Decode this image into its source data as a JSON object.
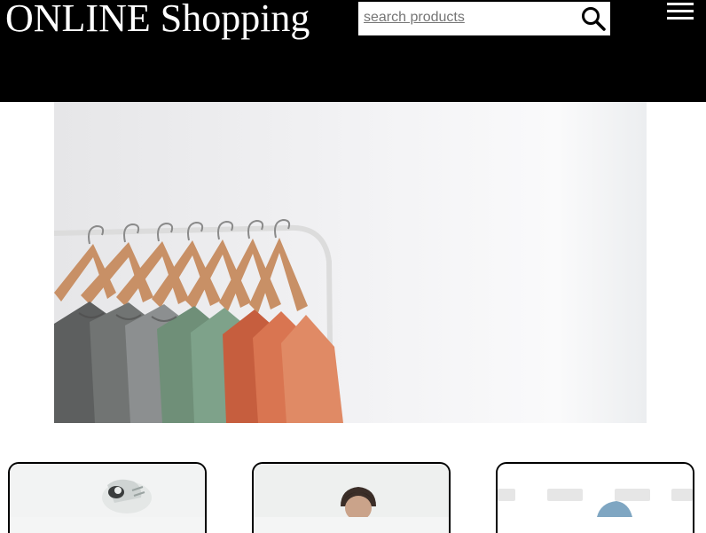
{
  "header": {
    "brand": "ONLINE Shopping",
    "search": {
      "placeholder": "search products",
      "icon": "search-icon"
    },
    "menu_icon": "hamburger-menu-icon"
  },
  "hero": {
    "image": "clothes-rack-photo"
  },
  "products": [
    {
      "image": "sneaker-photo"
    },
    {
      "image": "man-portrait-photo"
    },
    {
      "image": "watermarked-product-photo"
    }
  ],
  "colors": {
    "header_bg": "#000000",
    "text_light": "#ffffff",
    "card_border": "#000000"
  }
}
